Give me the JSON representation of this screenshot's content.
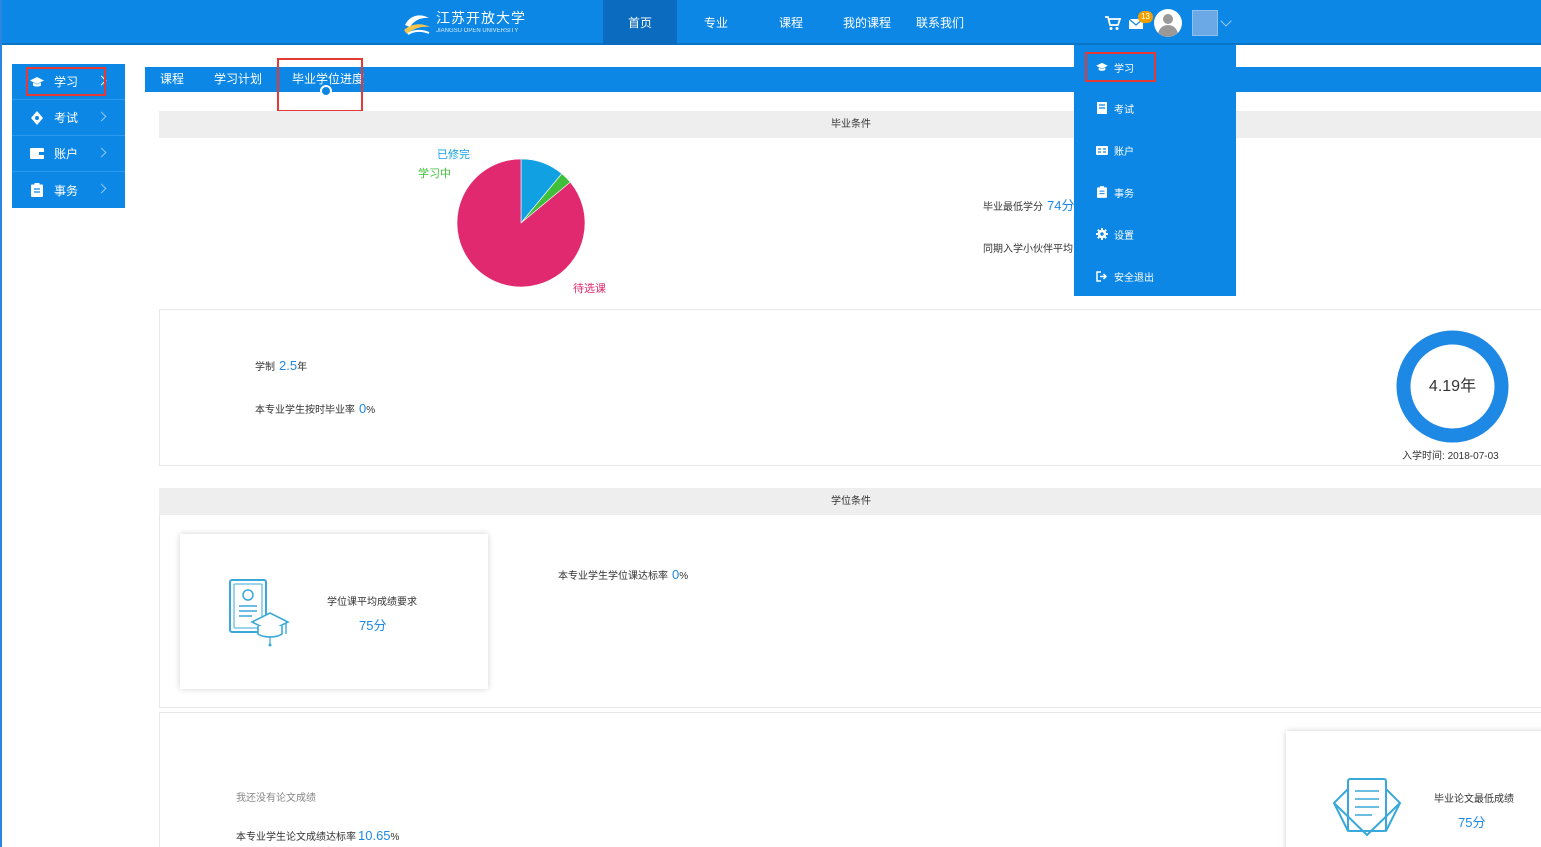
{
  "header": {
    "logo_cn": "江苏开放大学",
    "logo_en": "JIANGSU OPEN UNIVERSITY",
    "nav": [
      {
        "label": "首页",
        "active": true
      },
      {
        "label": "专业",
        "active": false
      },
      {
        "label": "课程",
        "active": false
      },
      {
        "label": "我的课程",
        "active": false
      },
      {
        "label": "联系我们",
        "active": false
      }
    ],
    "mail_badge": "13"
  },
  "sidebar": {
    "items": [
      {
        "label": "学习",
        "icon": "graduation-cap-icon"
      },
      {
        "label": "考试",
        "icon": "compass-icon"
      },
      {
        "label": "账户",
        "icon": "wallet-icon"
      },
      {
        "label": "事务",
        "icon": "clipboard-icon"
      }
    ]
  },
  "subnav": {
    "items": [
      {
        "label": "课程"
      },
      {
        "label": "学习计划"
      },
      {
        "label": "毕业学位进度",
        "current": true
      }
    ]
  },
  "graduation": {
    "title": "毕业条件",
    "chart_data": {
      "type": "pie",
      "categories": [
        "待选课",
        "学习中",
        "已修完"
      ],
      "values": [
        86,
        3,
        11
      ],
      "colors": [
        "#e0296f",
        "#3fbf3a",
        "#11a1e3"
      ]
    },
    "min_credit_label": "毕业最低学分",
    "min_credit_value": "74分",
    "peer_label": "同期入学小伙伴平均"
  },
  "term": {
    "system_label": "学制",
    "system_value": "2.5",
    "system_unit": "年",
    "ontime_label": "本专业学生按时毕业率",
    "ontime_value": "0",
    "ontime_unit": "%",
    "ring_value": "4.19年",
    "ring_progress": 1.0,
    "enroll_label": "入学时间:",
    "enroll_date": "2018-07-03"
  },
  "degree": {
    "title": "学位条件",
    "card_label": "学位课平均成绩要求",
    "card_value": "75分",
    "rate_label": "本专业学生学位课达标率",
    "rate_value": "0",
    "rate_unit": "%"
  },
  "thesis": {
    "no_score": "我还没有论文成绩",
    "rate_label": "本专业学生论文成绩达标率",
    "rate_value": "10.65",
    "rate_unit": "%",
    "card_label": "毕业论文最低成绩",
    "card_value": "75分"
  },
  "dropdown": {
    "items": [
      {
        "label": "学习",
        "icon": "graduation-cap-icon"
      },
      {
        "label": "考试",
        "icon": "book-icon"
      },
      {
        "label": "账户",
        "icon": "id-card-icon"
      },
      {
        "label": "事务",
        "icon": "clipboard-icon"
      },
      {
        "label": "设置",
        "icon": "gear-icon"
      },
      {
        "label": "安全退出",
        "icon": "logout-icon"
      }
    ]
  },
  "colors": {
    "primary": "#0c87e6",
    "accent_text": "#1e88e5",
    "highlight": "#e53935",
    "pie_pending": "#e0296f",
    "pie_studying": "#3fbf3a",
    "pie_done": "#11a1e3"
  }
}
